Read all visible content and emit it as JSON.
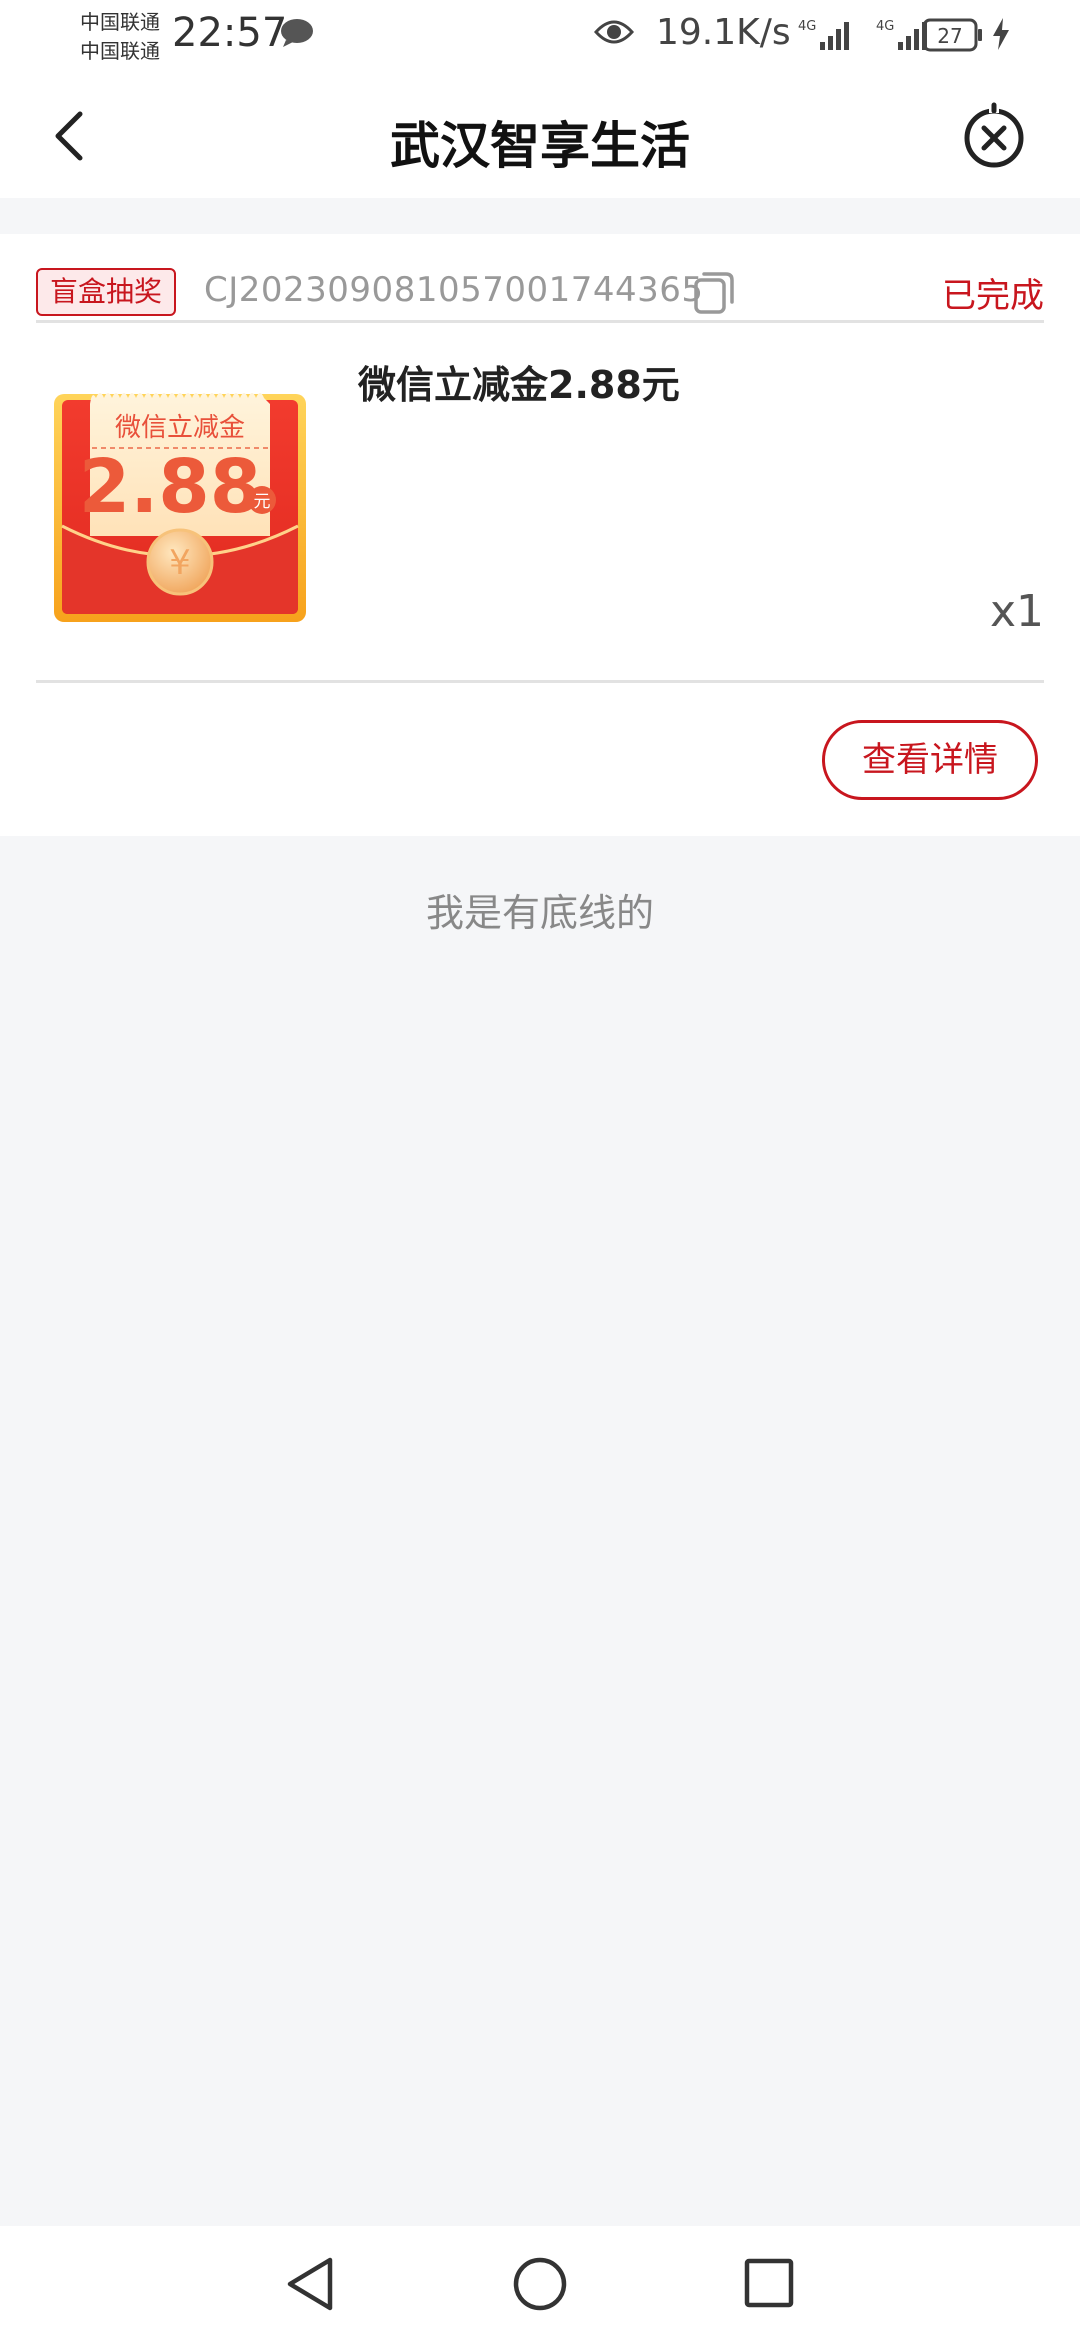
{
  "status_bar": {
    "carrier1": "中国联通",
    "carrier2": "中国联通",
    "time": "22:57",
    "net_speed": "19.1K/s",
    "battery": "27",
    "icons": [
      "message-icon",
      "eye-icon",
      "signal-4g-icon",
      "signal-4g-icon",
      "battery-icon",
      "charging-icon"
    ]
  },
  "header": {
    "title": "武汉智享生活",
    "back_icon": "chevron-left-icon",
    "close_icon": "close-circle-icon"
  },
  "order": {
    "tag": "盲盒抽奖",
    "order_no": "CJ20230908105700174436​5",
    "status": "已完成",
    "prize_title": "微信立减金2.88元",
    "quantity": "x1",
    "detail_button": "查看详情",
    "thumbnail": {
      "label": "微信立减金",
      "amount": "2.88",
      "unit": "元",
      "symbol": "¥"
    }
  },
  "footer_text": "我是有底线的",
  "colors": {
    "accent": "#c8161e",
    "background": "#f5f6f8"
  }
}
